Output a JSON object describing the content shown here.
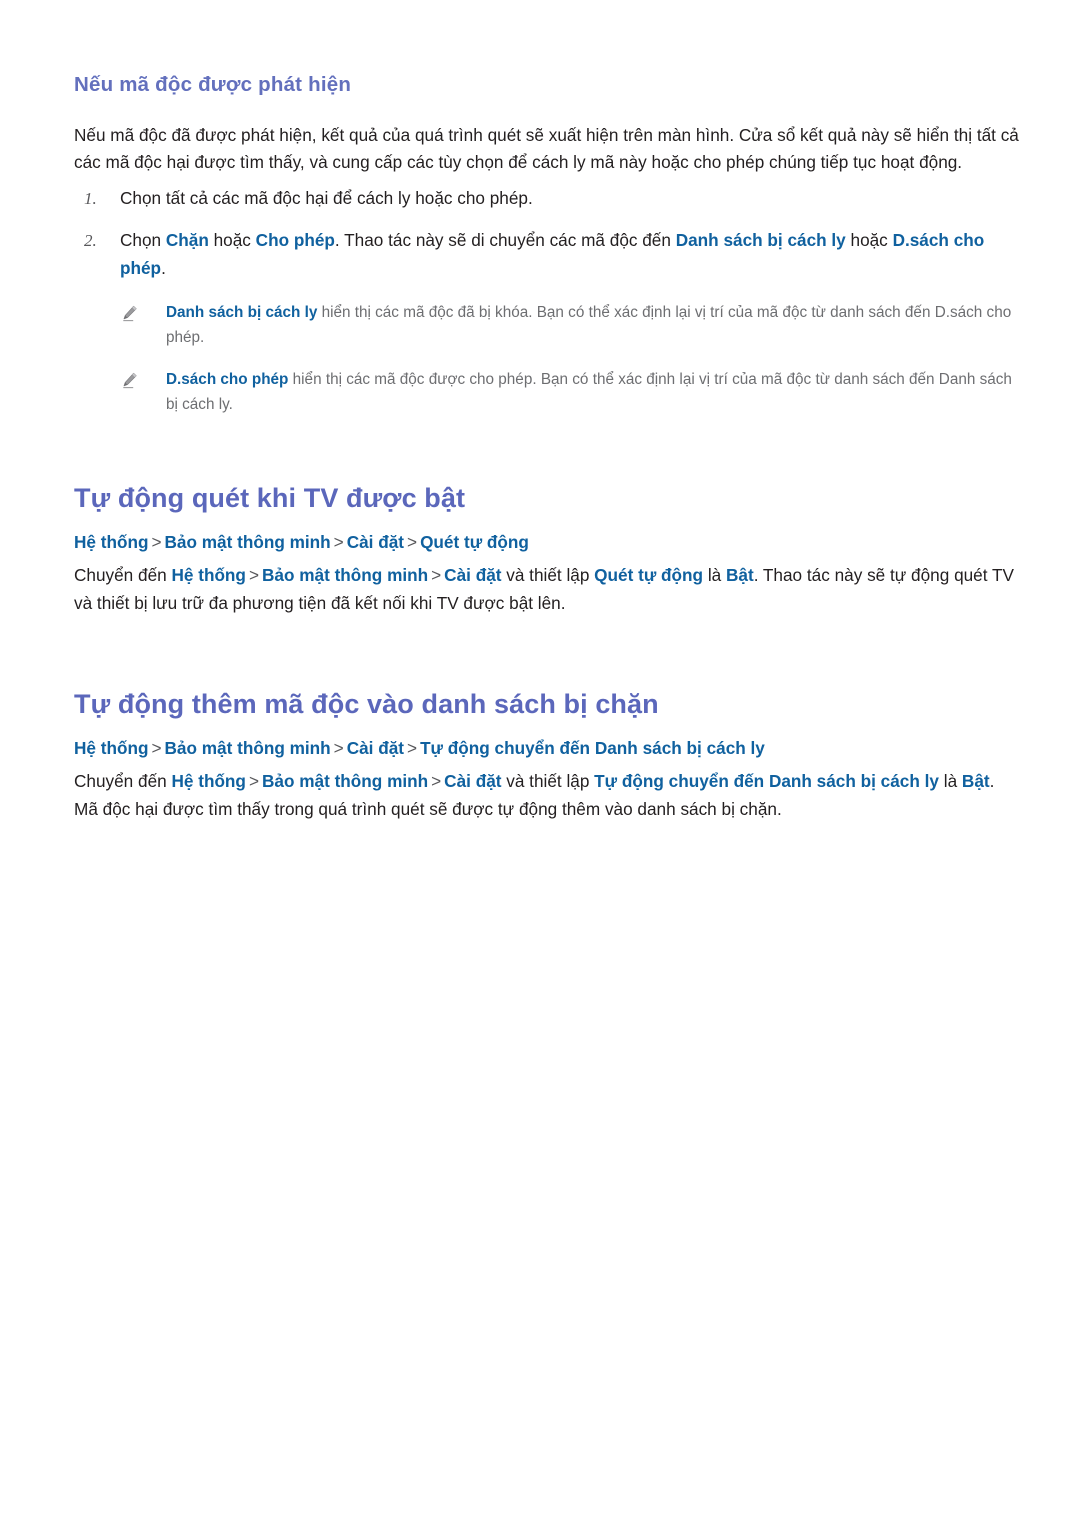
{
  "document": {
    "sections": [
      {
        "id": "malware-detected",
        "heading": "Nếu mã độc được phát hiện",
        "intro": "Nếu mã độc đã được phát hiện, kết quả của quá trình quét sẽ xuất hiện trên màn hình. Cửa sổ kết quả này sẽ hiển thị tất cả các mã độc hại được tìm thấy, và cung cấp các tùy chọn để cách ly mã này hoặc cho phép chúng tiếp tục hoạt động.",
        "steps": [
          {
            "number": "1.",
            "text": "Chọn tất cả các mã độc hại để cách ly hoặc cho phép."
          },
          {
            "number": "2.",
            "lead": "Chọn ",
            "kw1": "Chặn",
            "mid1": " hoặc ",
            "kw2": "Cho phép",
            "mid2": ". Thao tác này sẽ di chuyển các mã độc đến ",
            "kw3": "Danh sách bị cách ly",
            "mid3": " hoặc ",
            "kw4": "D.sách cho phép",
            "tail": "."
          }
        ],
        "notes": [
          {
            "icon": "pencil-icon",
            "kw": "Danh sách bị cách ly",
            "text": " hiển thị các mã độc đã bị khóa. Bạn có thể xác định lại vị trí của mã độc từ danh sách đến D.sách cho phép."
          },
          {
            "icon": "pencil-icon",
            "kw": "D.sách cho phép",
            "text": " hiển thị các mã độc được cho phép. Bạn có thể xác định lại vị trí của mã độc từ danh sách đến Danh sách bị cách ly."
          }
        ]
      },
      {
        "id": "auto-scan-on-tv-power",
        "heading": "Tự động quét khi TV được bật",
        "breadcrumb": {
          "separator": ">",
          "items": [
            "Hệ thống",
            "Bảo mật thông minh",
            "Cài đặt",
            "Quét tự động"
          ]
        },
        "paragraph": {
          "p1": "Chuyển đến ",
          "kw1": "Hệ thống",
          "s1": ">",
          "kw2": "Bảo mật thông minh",
          "s2": ">",
          "kw3": "Cài đặt",
          "p2": " và thiết lập ",
          "kw4": "Quét tự động",
          "p3": " là ",
          "kw5": "Bật",
          "p4": ". Thao tác này sẽ tự động quét TV và thiết bị lưu trữ đa phương tiện đã kết nối khi TV được bật lên."
        }
      },
      {
        "id": "auto-add-to-blocklist",
        "heading": "Tự động thêm mã độc vào danh sách bị chặn",
        "breadcrumb": {
          "separator": ">",
          "items": [
            "Hệ thống",
            "Bảo mật thông minh",
            "Cài đặt",
            "Tự động chuyển đến Danh sách bị cách ly"
          ]
        },
        "paragraph": {
          "p1": "Chuyển đến ",
          "kw1": "Hệ thống",
          "s1": ">",
          "kw2": "Bảo mật thông minh",
          "s2": ">",
          "kw3": "Cài đặt",
          "p2": " và thiết lập ",
          "kw4": "Tự động chuyển đến Danh sách bị cách ly",
          "p3": " là ",
          "kw5": "Bật",
          "p4": ". Mã độc hại được tìm thấy trong quá trình quét sẽ được tự động thêm vào danh sách bị chặn."
        }
      }
    ],
    "colors": {
      "heading_purple": "#5b67bb",
      "keyword_blue": "#10619f",
      "body_text": "#231f20",
      "note_text": "#6d6e71",
      "separator_gray": "#58585b",
      "background": "#ffffff"
    }
  }
}
